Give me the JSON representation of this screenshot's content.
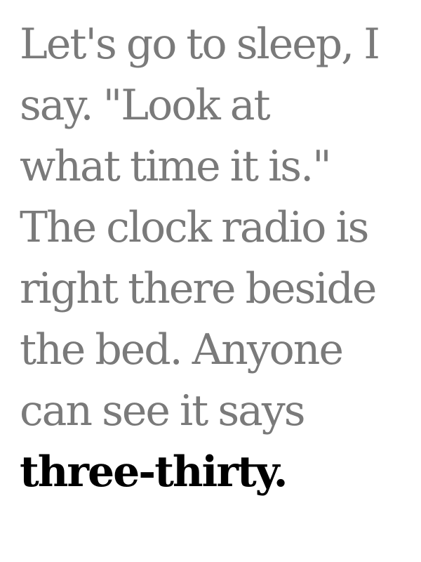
{
  "text": {
    "lines": [
      "Let's go to sleep, I",
      "say. \"Look at",
      "what time it is.\"",
      "The clock radio is",
      "right there beside",
      "the bed. Anyone",
      "can see it says"
    ],
    "highlighted_line": "three-thirty."
  },
  "colors": {
    "text_normal": "#7a7a7a",
    "text_highlight": "#000000",
    "background": "#ffffff"
  }
}
